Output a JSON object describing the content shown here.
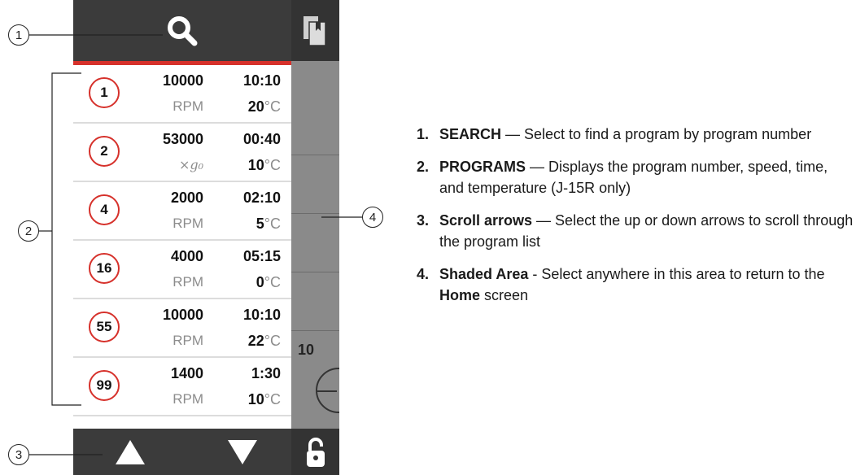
{
  "programs": [
    {
      "number": "1",
      "speed": "10000",
      "time": "10:10",
      "unit": "RPM",
      "temp": "20",
      "temp_unit": "°C"
    },
    {
      "number": "2",
      "speed": "53000",
      "time": "00:40",
      "unit": "×g₀",
      "temp": "10",
      "temp_unit": "°C"
    },
    {
      "number": "4",
      "speed": "2000",
      "time": "02:10",
      "unit": "RPM",
      "temp": "5",
      "temp_unit": "°C"
    },
    {
      "number": "16",
      "speed": "4000",
      "time": "05:15",
      "unit": "RPM",
      "temp": "0",
      "temp_unit": "°C"
    },
    {
      "number": "55",
      "speed": "10000",
      "time": "10:10",
      "unit": "RPM",
      "temp": "22",
      "temp_unit": "°C"
    },
    {
      "number": "99",
      "speed": "1400",
      "time": "1:30",
      "unit": "RPM",
      "temp": "10",
      "temp_unit": "°C"
    }
  ],
  "topbar": {
    "search_icon": "search-icon",
    "copy_icon": "copy-icon"
  },
  "bottombar": {
    "up_icon": "arrow-up-icon",
    "down_icon": "arrow-down-icon",
    "lock_icon": "lock-open-icon"
  },
  "shaded_area": {
    "value": "10"
  },
  "callouts": [
    "1",
    "2",
    "3",
    "4"
  ],
  "legend": [
    {
      "num": "1.",
      "term": "SEARCH",
      "text": " — Select to find a program by program number"
    },
    {
      "num": "2.",
      "term": "PROGRAMS",
      "text": " — Displays the program number, speed, time, and temperature (J-15R only)"
    },
    {
      "num": "3.",
      "term": "Scroll arrows",
      "text": " — Select the up or down arrows to scroll through the program list"
    },
    {
      "num": "4.",
      "term": "Shaded Area",
      "text": " - Select anywhere in this area to return to the ",
      "term2": "Home",
      "text2": " screen"
    }
  ],
  "colors": {
    "accent": "#d6312b",
    "bar": "#3b3b3b",
    "shade": "#8a8a8a"
  }
}
